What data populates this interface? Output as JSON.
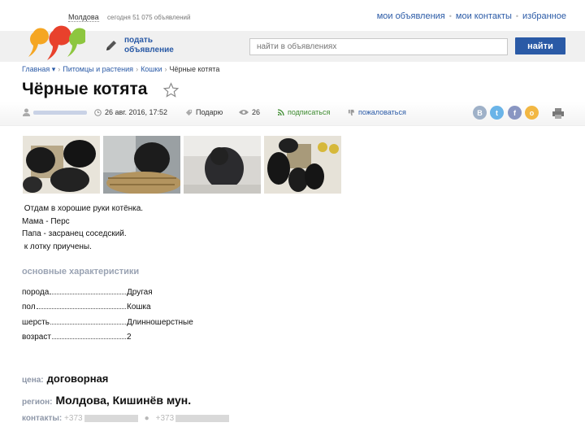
{
  "top": {
    "country": "Молдова",
    "counter": "сегодня 51 075 объявлений",
    "nav": [
      "мои объявления",
      "мои контакты",
      "избранное"
    ]
  },
  "header": {
    "post_ad_line1": "подать",
    "post_ad_line2": "объявление",
    "search_placeholder": "найти в объявлениях",
    "search_button": "найти"
  },
  "breadcrumbs": [
    "Главная ▾",
    "Питомцы и растения",
    "Кошки",
    "Чёрные котята"
  ],
  "title": "Чёрные котята",
  "meta": {
    "date": "26 авг. 2016, 17:52",
    "type": "Подарю",
    "views": "26",
    "subscribe": "подписаться",
    "complain": "пожаловаться"
  },
  "social": [
    {
      "icon": "vk-icon",
      "glyph": "B",
      "color": "#9fb1c8"
    },
    {
      "icon": "twitter-icon",
      "glyph": "t",
      "color": "#6ab4e8"
    },
    {
      "icon": "facebook-icon",
      "glyph": "f",
      "color": "#8996c2"
    },
    {
      "icon": "odnoklassniki-icon",
      "glyph": "o",
      "color": "#f2b743"
    }
  ],
  "description": [
    " Отдам в хорошие руки котёнка.",
    "Мама - Перс",
    "Папа - засранец соседский.",
    " к лотку приучены."
  ],
  "characteristics_title": "основные характеристики",
  "characteristics": [
    {
      "key": "порода",
      "value": "Другая"
    },
    {
      "key": "пол",
      "value": "Кошка"
    },
    {
      "key": "шерсть",
      "value": "Длинношерстные"
    },
    {
      "key": "возраст",
      "value": "2"
    }
  ],
  "price": {
    "label": "цена:",
    "value": "договорная"
  },
  "region": {
    "label": "регион:",
    "value": "Молдова, Кишинёв мун."
  },
  "contacts": {
    "label": "контакты:",
    "prefix": "+373"
  }
}
